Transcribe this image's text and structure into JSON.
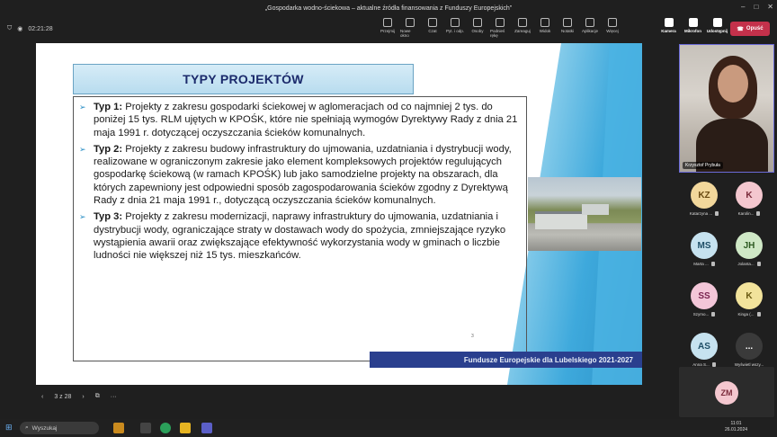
{
  "window": {
    "title": "„Gospodarka wodno-ściekowa – aktualne źródła finansowania z Funduszy Europejskich”"
  },
  "meeting": {
    "timer": "02:21:28"
  },
  "toolbar": {
    "tools": [
      {
        "label": "Przejmij",
        "icon": "share-icon"
      },
      {
        "label": "Nowe okno",
        "icon": "new-window-icon"
      },
      {
        "label": "Czat",
        "icon": "chat-icon"
      },
      {
        "label": "Pyt. i odp.",
        "icon": "qa-icon"
      },
      {
        "label": "Osoby",
        "icon": "people-icon"
      },
      {
        "label": "Podnieś rękę",
        "icon": "raise-hand-icon"
      },
      {
        "label": "Zareaguj",
        "icon": "react-icon"
      },
      {
        "label": "Widok",
        "icon": "view-icon"
      },
      {
        "label": "Notatki",
        "icon": "notes-icon"
      },
      {
        "label": "Aplikacje",
        "icon": "apps-icon"
      },
      {
        "label": "Więcej",
        "icon": "more-icon"
      }
    ],
    "camera_label": "Kamera",
    "mic_label": "Mikrofon",
    "share_label": "Udostępnij",
    "leave_label": "Opuść"
  },
  "slide": {
    "title": "TYPY PROJEKTÓW",
    "items": [
      {
        "type": "Typ 1:",
        "text": " Projekty z zakresu gospodarki ściekowej w aglomeracjach od co najmniej 2 tys. do poniżej 15 tys. RLM ujętych w KPOŚK, które nie spełniają wymogów Dyrektywy Rady z dnia 21 maja 1991 r. dotyczącej oczyszczania ścieków komunalnych."
      },
      {
        "type": "Typ 2:",
        "text": " Projekty z zakresu budowy infrastruktury do ujmowania, uzdatniania i dystrybucji wody, realizowane w ograniczonym zakresie jako element kompleksowych projektów regulujących gospodarkę ściekową (w ramach KPOŚK) lub jako samodzielne projekty na obszarach, dla których zapewniony jest odpowiedni sposób zagospodarowania ścieków zgodny z Dyrektywą Rady z dnia 21 maja 1991 r., dotyczącą oczyszczania ścieków komunalnych."
      },
      {
        "type": "Typ 3:",
        "text": " Projekty z zakresu modernizacji, naprawy infrastruktury do ujmowania, uzdatniania i dystrybucji wody, ograniczające straty w dostawach wody do spożycia, zmniejszające ryzyko wystąpienia awarii oraz zwiększające efektywność wykorzystania wody w gminach o liczbie ludności nie większej niż 15 tys. mieszkańców."
      }
    ],
    "footer": "Fundusze Europejskie dla Lubelskiego 2021-2027",
    "page_number": "3"
  },
  "slide_nav": {
    "counter": "3 z 28"
  },
  "participants": {
    "self_name": "Krzysztof Prybuła",
    "list": [
      {
        "initials": "KZ",
        "name": "Katarzyna ...",
        "bg": "#f2d79b",
        "fg": "#6a4a12"
      },
      {
        "initials": "K",
        "name": "Karolin...",
        "bg": "#f4c7cf",
        "fg": "#7a2a3a"
      },
      {
        "initials": "MS",
        "name": "Marta ...",
        "bg": "#c6e2ef",
        "fg": "#1e4e66"
      },
      {
        "initials": "JH",
        "name": "Jolanta...",
        "bg": "#cfe8c6",
        "fg": "#2d5a22"
      },
      {
        "initials": "SS",
        "name": "Szymo...",
        "bg": "#f3c6d8",
        "fg": "#7a2550"
      },
      {
        "initials": "K",
        "name": "Kinga (...",
        "bg": "#f2e39b",
        "fg": "#6a5a12"
      },
      {
        "initials": "AS",
        "name": "Anna S...",
        "bg": "#c6e2ef",
        "fg": "#1e4e66"
      },
      {
        "initials": "...",
        "name": "Wyświetl wszy...",
        "bg": "#3a3a3a",
        "fg": "#ffffff"
      }
    ],
    "bottom_tile": {
      "initials": "ZM",
      "bg": "#f4c7cf",
      "fg": "#7a2a3a"
    }
  },
  "taskbar": {
    "search_placeholder": "Wyszukaj",
    "time": "11:01",
    "date": "26.01.2024"
  }
}
